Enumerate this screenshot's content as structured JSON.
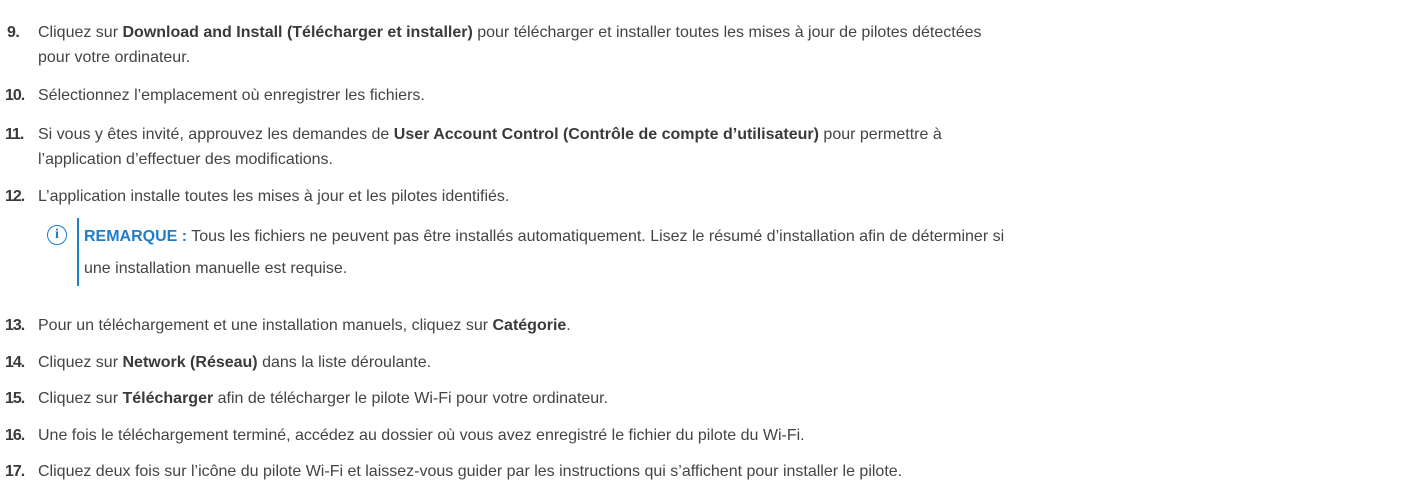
{
  "steps": [
    {
      "number": "9.",
      "before": "Cliquez sur ",
      "bold": "Download and Install (Télécharger et installer)",
      "after_line1": " pour télécharger et installer toutes les mises à jour de pilotes détectées",
      "line2": "pour votre ordinateur."
    },
    {
      "number": "10.",
      "text": "Sélectionnez l’emplacement où enregistrer les fichiers."
    },
    {
      "number": "11.",
      "before": "Si vous y êtes invité, approuvez les demandes de ",
      "bold": "User Account Control (Contrôle de compte d’utilisateur)",
      "after_line1": " pour permettre à",
      "line2": "l’application d’effectuer des modifications."
    },
    {
      "number": "12.",
      "text": "L’application installe toutes les mises à jour et les pilotes identifiés."
    },
    {
      "number": "13.",
      "before": "Pour un téléchargement et une installation manuels, cliquez sur ",
      "bold": "Catégorie",
      "after": "."
    },
    {
      "number": "14.",
      "before": "Cliquez sur ",
      "bold": "Network (Réseau)",
      "after": " dans la liste déroulante."
    },
    {
      "number": "15.",
      "before": "Cliquez sur ",
      "bold": "Télécharger",
      "after": " afin de télécharger le pilote Wi-Fi pour votre ordinateur."
    },
    {
      "number": "16.",
      "text": "Une fois le téléchargement terminé, accédez au dossier où vous avez enregistré le fichier du pilote du Wi-Fi."
    },
    {
      "number": "17.",
      "text": "Cliquez deux fois sur l’icône du pilote Wi-Fi et laissez-vous guider par les instructions qui s’affichent pour installer le pilote."
    }
  ],
  "note": {
    "icon": "info-icon",
    "icon_glyph": "i",
    "label": "REMARQUE :",
    "line1": " Tous les fichiers ne peuvent pas être installés automatiquement. Lisez le résumé d’installation afin de déterminer si",
    "line2": "une installation manuelle est requise.",
    "accent_color": "#1e7ec8"
  }
}
